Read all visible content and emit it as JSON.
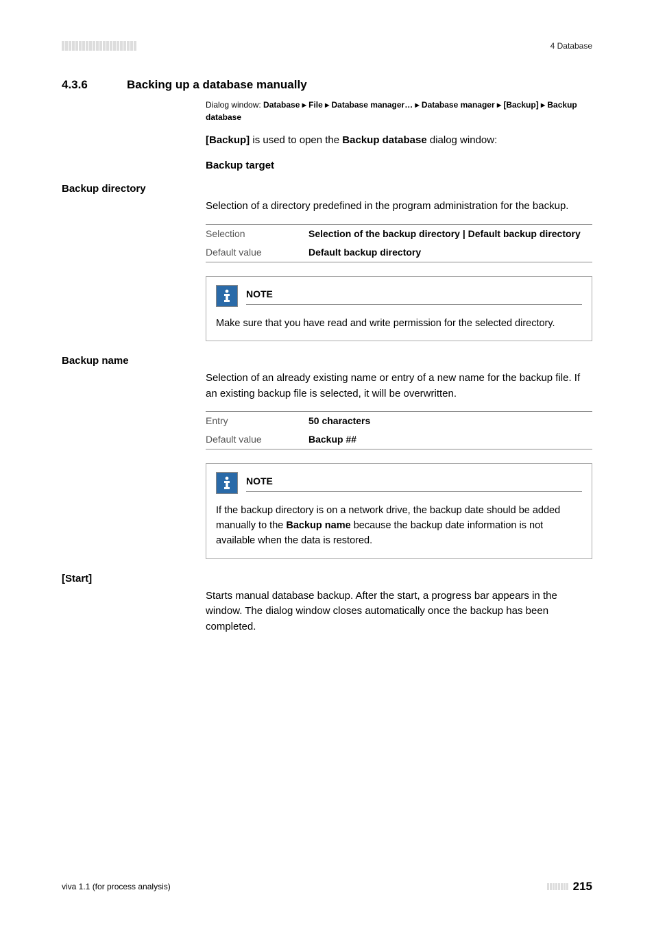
{
  "header": {
    "chapter": "4 Database"
  },
  "section": {
    "number": "4.3.6",
    "title": "Backing up a database manually"
  },
  "dialog_path": {
    "prefix": "Dialog window: ",
    "p1": "Database",
    "p2": "File",
    "p3": "Database manager…",
    "p4": "Database manager",
    "p5": "[Backup]",
    "p6": "Backup database"
  },
  "intro": {
    "t1": "[Backup]",
    "t2": " is used to open the ",
    "t3": "Backup database",
    "t4": " dialog window:"
  },
  "backup_target_head": "Backup target",
  "backup_directory": {
    "label": "Backup directory",
    "desc": "Selection of a directory predefined in the program administration for the backup.",
    "row1_key": "Selection",
    "row1_val": "Selection of the backup directory | Default backup directory",
    "row2_key": "Default value",
    "row2_val": "Default backup directory",
    "note_title": "NOTE",
    "note_text": "Make sure that you have read and write permission for the selected directory."
  },
  "backup_name": {
    "label": "Backup name",
    "desc": "Selection of an already existing name or entry of a new name for the backup file. If an existing backup file is selected, it will be overwritten.",
    "row1_key": "Entry",
    "row1_val": "50 characters",
    "row2_key": "Default value",
    "row2_val": "Backup ##",
    "note_title": "NOTE",
    "note_t1": "If the backup directory is on a network drive, the backup date should be added manually to the ",
    "note_t2": "Backup name",
    "note_t3": " because the backup date information is not available when the data is restored."
  },
  "start": {
    "label": "[Start]",
    "desc": "Starts manual database backup. After the start, a progress bar appears in the window. The dialog window closes automatically once the backup has been completed."
  },
  "footer": {
    "left": "viva 1.1 (for process analysis)",
    "page": "215"
  }
}
